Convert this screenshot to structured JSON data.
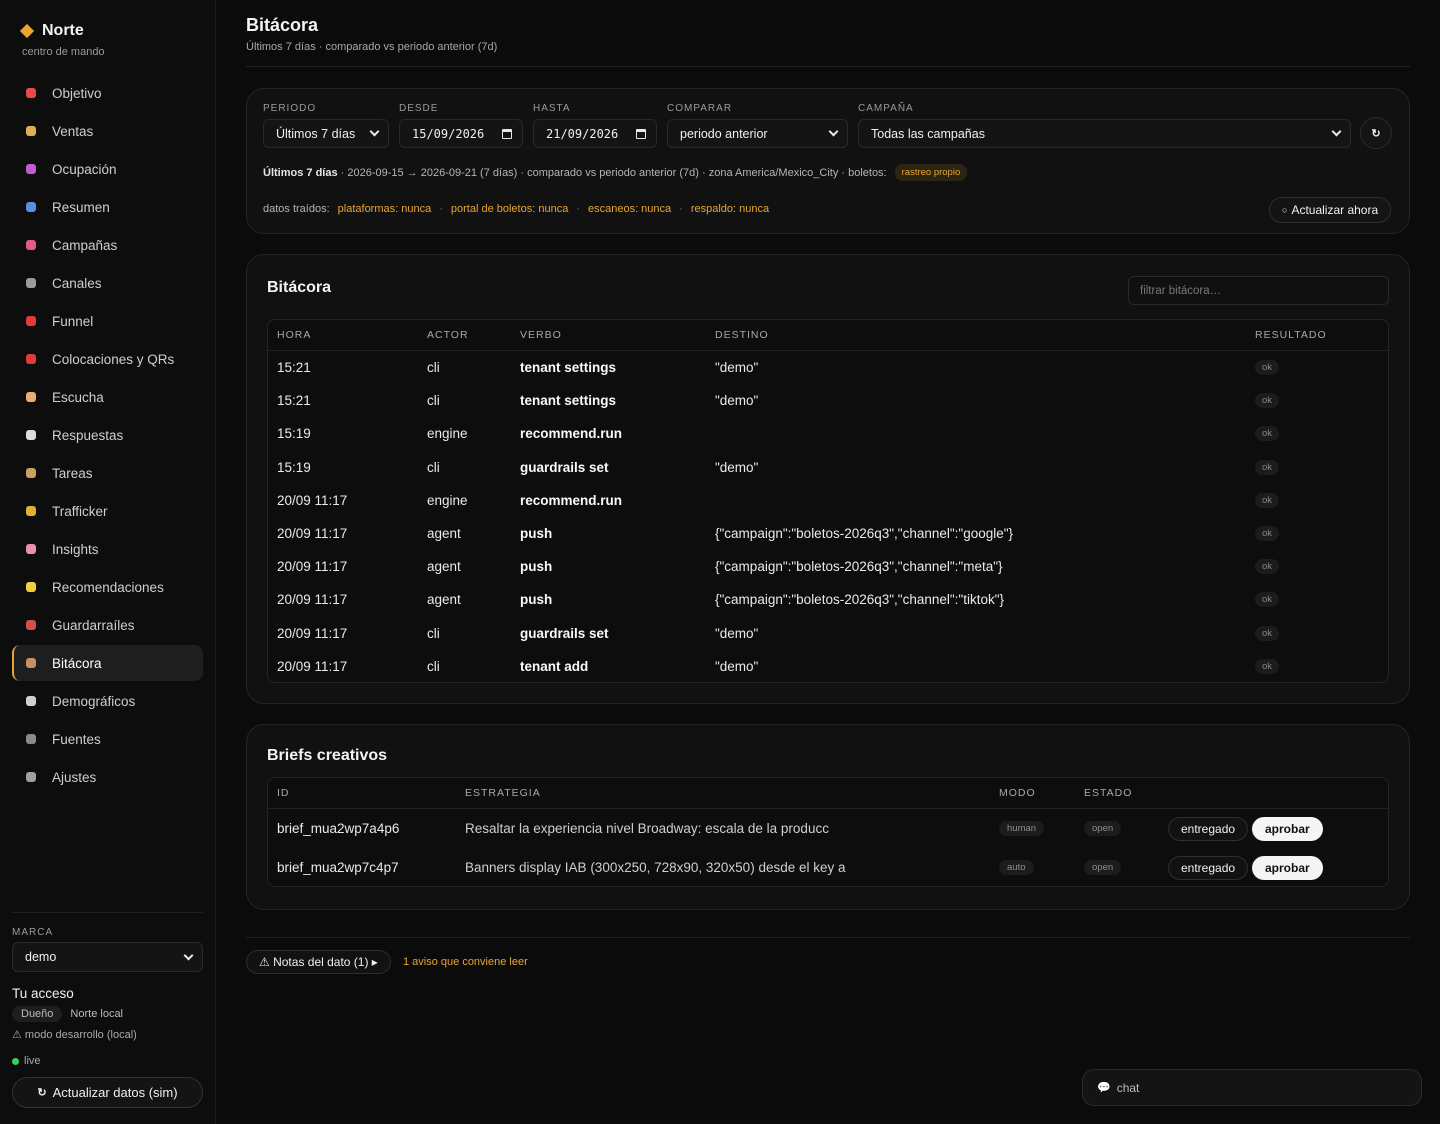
{
  "brand": {
    "name": "Norte",
    "subtitle": "centro de mando"
  },
  "nav": [
    {
      "label": "Objetivo",
      "icon": "target-icon",
      "color": "#e84a4a"
    },
    {
      "label": "Ventas",
      "icon": "money-bag-icon",
      "color": "#e0b050"
    },
    {
      "label": "Ocupación",
      "icon": "theater-icon",
      "color": "#c05ad0"
    },
    {
      "label": "Resumen",
      "icon": "bar-chart-icon",
      "color": "#5a8ee0"
    },
    {
      "label": "Campañas",
      "icon": "trend-chart-icon",
      "color": "#e05a8a"
    },
    {
      "label": "Canales",
      "icon": "satellite-icon",
      "color": "#9a9a9a"
    },
    {
      "label": "Funnel",
      "icon": "funnel-icon",
      "color": "#e03a3a"
    },
    {
      "label": "Colocaciones y QRs",
      "icon": "pin-icon",
      "color": "#e03a3a"
    },
    {
      "label": "Escucha",
      "icon": "ear-icon",
      "color": "#e8b070"
    },
    {
      "label": "Respuestas",
      "icon": "speech-bubble-icon",
      "color": "#dcdcdc"
    },
    {
      "label": "Tareas",
      "icon": "clipboard-icon",
      "color": "#c8a060"
    },
    {
      "label": "Trafficker",
      "icon": "traffic-light-icon",
      "color": "#e0b030"
    },
    {
      "label": "Insights",
      "icon": "brain-icon",
      "color": "#e890b0"
    },
    {
      "label": "Recomendaciones",
      "icon": "lightbulb-icon",
      "color": "#f0d040"
    },
    {
      "label": "Guardarraíles",
      "icon": "shield-icon",
      "color": "#d05050"
    },
    {
      "label": "Bitácora",
      "icon": "scroll-icon",
      "color": "#c89060",
      "active": true
    },
    {
      "label": "Demográficos",
      "icon": "compass-icon",
      "color": "#d0d0d0"
    },
    {
      "label": "Fuentes",
      "icon": "plug-icon",
      "color": "#8a8a8a"
    },
    {
      "label": "Ajustes",
      "icon": "gear-icon",
      "color": "#a0a0a0"
    }
  ],
  "sidebar_bottom": {
    "brand_label": "MARCA",
    "brand_value": "demo",
    "access_title": "Tu acceso",
    "role": "Dueño",
    "role_scope": "Norte local",
    "dev_mode": "⚠ modo desarrollo (local)",
    "live": "live",
    "refresh_label": "Actualizar datos (sim)",
    "refresh_icon": "↻"
  },
  "header": {
    "title": "Bitácora",
    "subtitle": "Últimos 7 días · comparado vs periodo anterior (7d)"
  },
  "filters": {
    "periodo": {
      "label": "PERIODO",
      "value": "Últimos 7 días"
    },
    "desde": {
      "label": "DESDE",
      "value": "15/09/2026"
    },
    "hasta": {
      "label": "HASTA",
      "value": "21/09/2026"
    },
    "comparar": {
      "label": "COMPARAR",
      "value": "periodo anterior"
    },
    "campana": {
      "label": "CAMPAÑA",
      "value": "Todas las campañas"
    },
    "refresh_icon": "↻",
    "summary_bold": "Últimos 7 días",
    "summary_text": " · 2026-09-15 → 2026-09-21 (7 días) · comparado vs periodo anterior (7d) · zona America/Mexico_City · boletos:",
    "summary_badge": "rastreo propio",
    "data_label": "datos traídos:",
    "data_sources": [
      "plataformas: nunca",
      "portal de boletos: nunca",
      "escaneos: nunca",
      "respaldo: nunca"
    ],
    "data_sep": "·",
    "update_label": "Actualizar ahora",
    "update_icon": "○"
  },
  "log": {
    "title": "Bitácora",
    "filter_placeholder": "filtrar bitácora…",
    "columns": {
      "hora": "HORA",
      "actor": "ACTOR",
      "verbo": "VERBO",
      "destino": "DESTINO",
      "resultado": "RESULTADO"
    },
    "rows": [
      {
        "hora": "15:21",
        "actor": "cli",
        "verbo": "tenant settings",
        "destino": "\"demo\"",
        "resultado": "ok"
      },
      {
        "hora": "15:21",
        "actor": "cli",
        "verbo": "tenant settings",
        "destino": "\"demo\"",
        "resultado": "ok"
      },
      {
        "hora": "15:19",
        "actor": "engine",
        "verbo": "recommend.run",
        "destino": "",
        "resultado": "ok"
      },
      {
        "hora": "15:19",
        "actor": "cli",
        "verbo": "guardrails set",
        "destino": "\"demo\"",
        "resultado": "ok"
      },
      {
        "hora": "20/09 11:17",
        "actor": "engine",
        "verbo": "recommend.run",
        "destino": "",
        "resultado": "ok"
      },
      {
        "hora": "20/09 11:17",
        "actor": "agent",
        "verbo": "push",
        "destino": "{\"campaign\":\"boletos-2026q3\",\"channel\":\"google\"}",
        "resultado": "ok"
      },
      {
        "hora": "20/09 11:17",
        "actor": "agent",
        "verbo": "push",
        "destino": "{\"campaign\":\"boletos-2026q3\",\"channel\":\"meta\"}",
        "resultado": "ok"
      },
      {
        "hora": "20/09 11:17",
        "actor": "agent",
        "verbo": "push",
        "destino": "{\"campaign\":\"boletos-2026q3\",\"channel\":\"tiktok\"}",
        "resultado": "ok"
      },
      {
        "hora": "20/09 11:17",
        "actor": "cli",
        "verbo": "guardrails set",
        "destino": "\"demo\"",
        "resultado": "ok"
      },
      {
        "hora": "20/09 11:17",
        "actor": "cli",
        "verbo": "tenant add",
        "destino": "\"demo\"",
        "resultado": "ok"
      }
    ]
  },
  "briefs": {
    "title": "Briefs creativos",
    "columns": {
      "id": "ID",
      "estrategia": "ESTRATEGIA",
      "modo": "MODO",
      "estado": "ESTADO"
    },
    "rows": [
      {
        "id": "brief_mua2wp7a4p6",
        "estrategia": "Resaltar la experiencia nivel Broadway: escala de la producc",
        "modo": "human",
        "estado": "open",
        "btn1": "entregado",
        "btn2": "aprobar"
      },
      {
        "id": "brief_mua2wp7c4p7",
        "estrategia": "Banners display IAB (300x250, 728x90, 320x50) desde el key a",
        "modo": "auto",
        "estado": "open",
        "btn1": "entregado",
        "btn2": "aprobar"
      }
    ]
  },
  "notes": {
    "button": "⚠ Notas del dato (1) ▸",
    "warning": "1 aviso que conviene leer"
  },
  "chat": {
    "icon": "💬",
    "label": "chat"
  }
}
